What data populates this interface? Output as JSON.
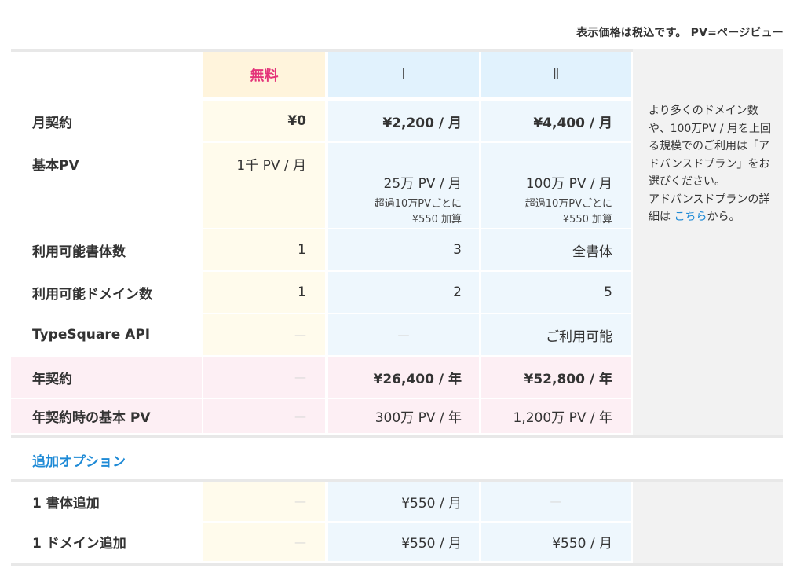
{
  "note": "表示価格は税込です。 PV=ページビュー",
  "plans": {
    "free": "無料",
    "p1": "Ⅰ",
    "p2": "Ⅱ"
  },
  "rows": [
    {
      "label": "月契約",
      "free": "¥0",
      "p1": "¥2,200 / 月",
      "p2": "¥4,400 / 月"
    },
    {
      "label": "基本PV",
      "free": "1千 PV / 月",
      "p1": "25万 PV / 月",
      "p1_sub1": "超過10万PVごとに",
      "p1_sub2": "¥550 加算",
      "p2": "100万 PV / 月",
      "p2_sub1": "超過10万PVごとに",
      "p2_sub2": "¥550 加算"
    },
    {
      "label": "利用可能書体数",
      "free": "1",
      "p1": "3",
      "p2": "全書体"
    },
    {
      "label": "利用可能ドメイン数",
      "free": "1",
      "p1": "2",
      "p2": "5"
    },
    {
      "label": "TypeSquare API",
      "free": "—",
      "p1": "—",
      "p2": "ご利用可能"
    },
    {
      "label": "年契約",
      "free": "—",
      "p1": "¥26,400 / 年",
      "p2": "¥52,800 / 年"
    },
    {
      "label": "年契約時の基本 PV",
      "free": "—",
      "p1": "300万 PV / 年",
      "p2": "1,200万 PV / 年"
    }
  ],
  "side": {
    "text": "より多くのドメイン数や、100万PV / 月を上回る規模でのご利用は「アドバンスドプラン」をお選びください。",
    "text2": "アドバンスドプランの詳細は ",
    "link": "こちら",
    "text3": "から。"
  },
  "options": {
    "title": "追加オプション",
    "rows": [
      {
        "label": "1 書体追加",
        "free": "—",
        "p1": "¥550 / 月",
        "p2": "—"
      },
      {
        "label": "1 ドメイン追加",
        "free": "—",
        "p1": "¥550 / 月",
        "p2": "¥550 / 月"
      }
    ]
  }
}
